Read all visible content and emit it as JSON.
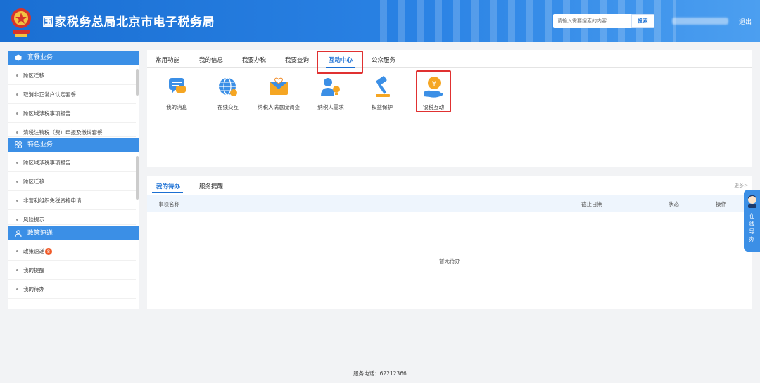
{
  "header": {
    "title": "国家税务总局北京市电子税务局",
    "search_placeholder": "请输入需要搜索的内容",
    "search_button": "搜索",
    "logout": "退出"
  },
  "sidebar": {
    "sections": [
      {
        "title": "套餐业务",
        "icon": "cube-icon",
        "items": [
          "跨区迁移",
          "取消非正常户认定套餐",
          "跨区域涉税事项报告",
          "清税注销税（费）申报及缴纳套餐"
        ]
      },
      {
        "title": "特色业务",
        "icon": "grid-icon",
        "items": [
          "跨区域涉税事项报告",
          "跨区迁移",
          "非营利组织免税资格申请",
          "风险提示"
        ]
      },
      {
        "title": "政策速递",
        "icon": "user-icon",
        "items": [
          "政策速递",
          "我的提醒",
          "我的待办"
        ],
        "badge": "8"
      }
    ]
  },
  "tabs": [
    "常用功能",
    "我的信息",
    "我要办税",
    "我要查询",
    "互动中心",
    "公众服务"
  ],
  "active_tab": "互动中心",
  "services": [
    {
      "label": "我的消息",
      "icon": "message-icon"
    },
    {
      "label": "在线交互",
      "icon": "globe-icon"
    },
    {
      "label": "纳税人满意度调查",
      "icon": "envelope-heart-icon"
    },
    {
      "label": "纳税人需求",
      "icon": "person-bulb-icon"
    },
    {
      "label": "权益保护",
      "icon": "gavel-icon"
    },
    {
      "label": "银税互动",
      "icon": "hand-coin-icon"
    }
  ],
  "todo": {
    "tabs": [
      "我的待办",
      "服务提醒"
    ],
    "more": "更多>",
    "columns": [
      "事项名称",
      "截止日期",
      "状态",
      "操作"
    ],
    "empty": "暂无待办"
  },
  "guide": {
    "text": [
      "在",
      "线",
      "导",
      "办"
    ]
  },
  "footer": "服务电话：62212366",
  "colors": {
    "brand_blue": "#1a6fd3",
    "highlight_red": "#e03131",
    "badge_orange": "#f05a28"
  }
}
